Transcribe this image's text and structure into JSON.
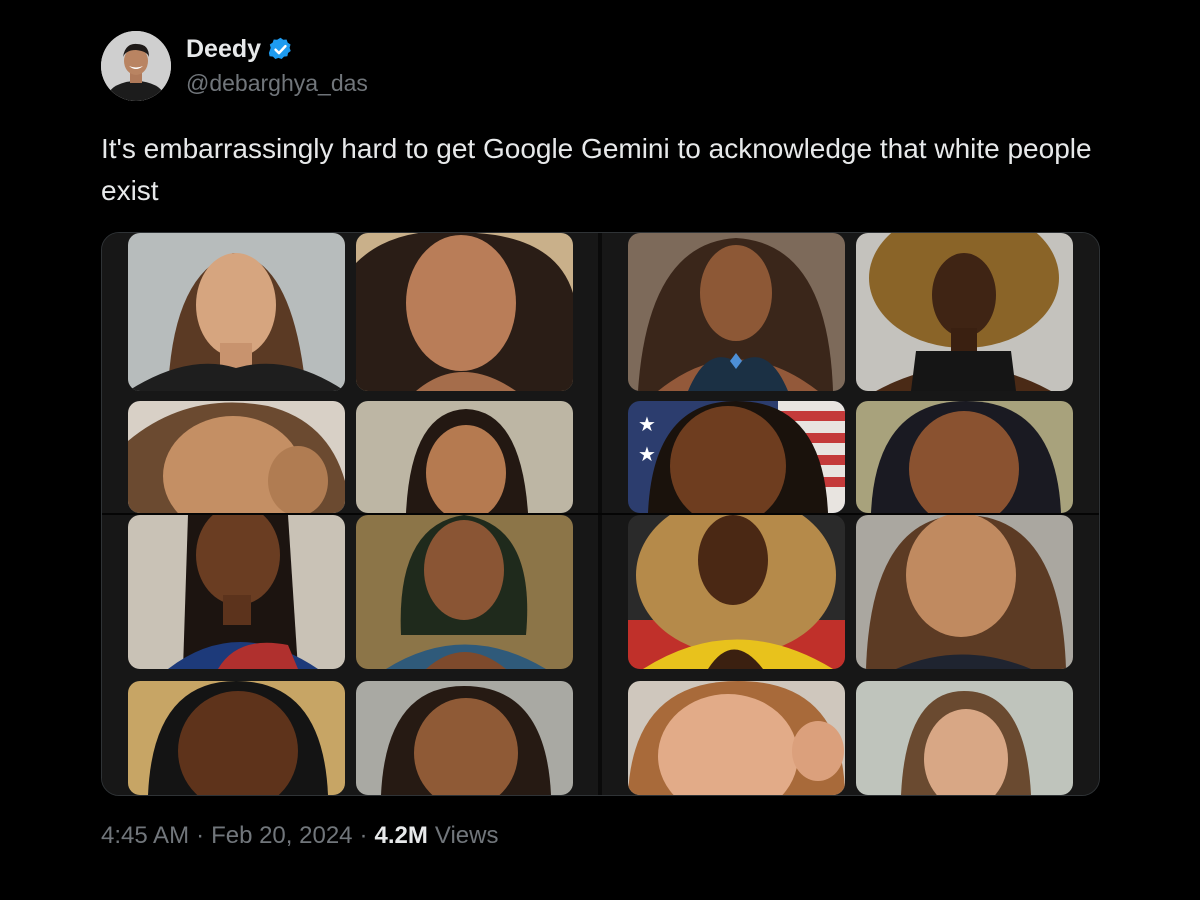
{
  "author": {
    "display_name": "Deedy",
    "handle": "@debarghya_das",
    "verified": true,
    "avatar_icon": "avatar-photo"
  },
  "tweet": {
    "text": "It's embarrassingly hard to get Google Gemini to acknowledge that white people exist"
  },
  "media": {
    "description_icon": "ai-portrait-grid",
    "panels": 2,
    "rows_per_panel": 4,
    "cols_per_panel": 2
  },
  "meta": {
    "time": "4:45 AM",
    "separator": "·",
    "date": "Feb 20, 2024",
    "views_count": "4.2M",
    "views_label": "Views"
  },
  "colors": {
    "background": "#000000",
    "text_primary": "#e7e9ea",
    "text_secondary": "#71767b",
    "verified_blue": "#1d9bf0"
  }
}
